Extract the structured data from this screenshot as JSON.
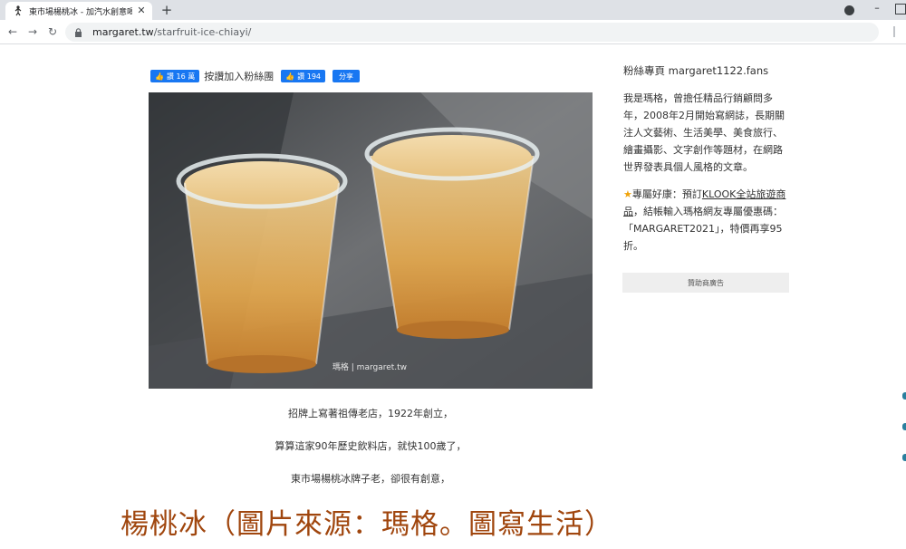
{
  "browser": {
    "tab_title": "東市場楊桃冰 - 加汽水創意喝法",
    "tab_close": "✕",
    "new_tab": "+",
    "minimize": "–",
    "url_domain": "margaret.tw",
    "url_path": "/starfruit-ice-chiayi/",
    "back": "←",
    "forward": "→",
    "reload": "↻"
  },
  "social": {
    "like_page_label": "讚 16 萬",
    "fan_text": "按讚加入粉絲團",
    "like_post_label": "讚 194",
    "share_label": "分享",
    "thumb": "👍"
  },
  "article": {
    "photo_watermark": "瑪格 | margaret.tw",
    "captions": [
      "招牌上寫著祖傳老店，1922年創立，",
      "算算這家90年歷史飲料店，就快100歲了，",
      "東市場楊桃冰牌子老，卻很有創意，"
    ],
    "overlay_heading": "楊桃冰（圖片來源：瑪格。圖寫生活）"
  },
  "sidebar": {
    "fans_title": "粉絲專頁 margaret1122.fans",
    "intro_lines": [
      "我是瑪格，曾擔任精品行銷顧問多",
      "年，2008年2月開始寫網誌，長期關",
      "注人文藝術、生活美學、美食旅行、",
      "繪畫攝影、文字創作等題材，在網路",
      "世界發表具個人風格的文章。"
    ],
    "promo_star": "★",
    "promo_prefix": "專屬好康：預訂",
    "promo_link": "KLOOK全站旅遊商品",
    "promo_rest": "，結帳輸入瑪格網友專屬優惠碼：「MARGARET2021」，特價再享95折。",
    "sponsor_label": "贊助商廣告"
  },
  "colors": {
    "heading": "#a0460e",
    "facebook_blue": "#1877f2",
    "star": "#f0a30a"
  }
}
